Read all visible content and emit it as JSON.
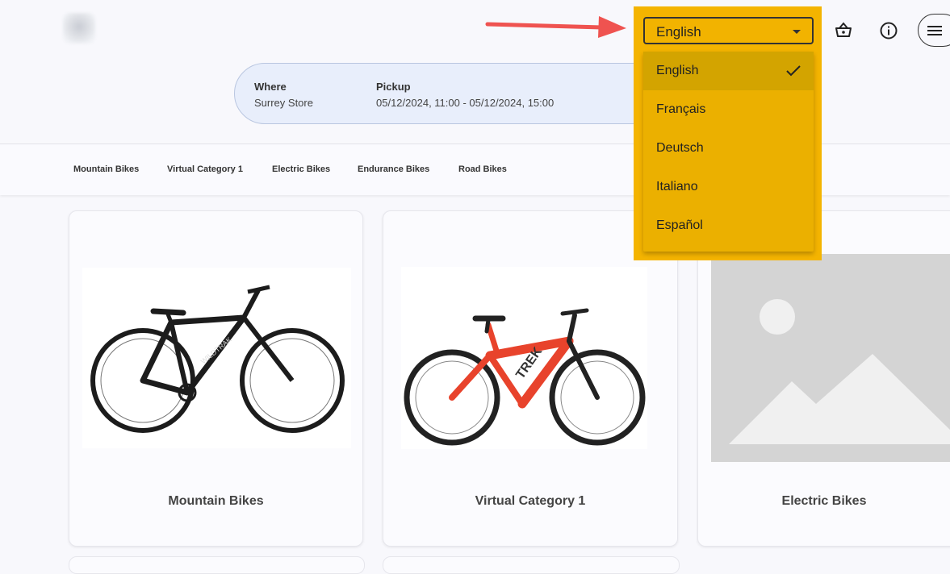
{
  "header": {
    "language_selected": "English",
    "icons": [
      "basket-icon",
      "info-icon",
      "hamburger-menu-icon"
    ]
  },
  "booking": {
    "where_label": "Where",
    "where_value": "Surrey Store",
    "pickup_label": "Pickup",
    "pickup_value": "05/12/2024, 11:00 - 05/12/2024, 15:00"
  },
  "categories_nav": [
    "Mountain Bikes",
    "Virtual Category 1",
    "Electric Bikes",
    "Endurance Bikes",
    "Road Bikes"
  ],
  "language_menu": {
    "options": [
      "English",
      "Français",
      "Deutsch",
      "Italiano",
      "Español"
    ],
    "selected_index": 0
  },
  "cards": [
    {
      "title": "Mountain Bikes"
    },
    {
      "title": "Virtual Category 1"
    },
    {
      "title": "Electric Bikes"
    }
  ],
  "colors": {
    "highlight": "#f4b400",
    "pointer_arrow": "#ef5350",
    "info_card_bg": "#e8eefb"
  }
}
